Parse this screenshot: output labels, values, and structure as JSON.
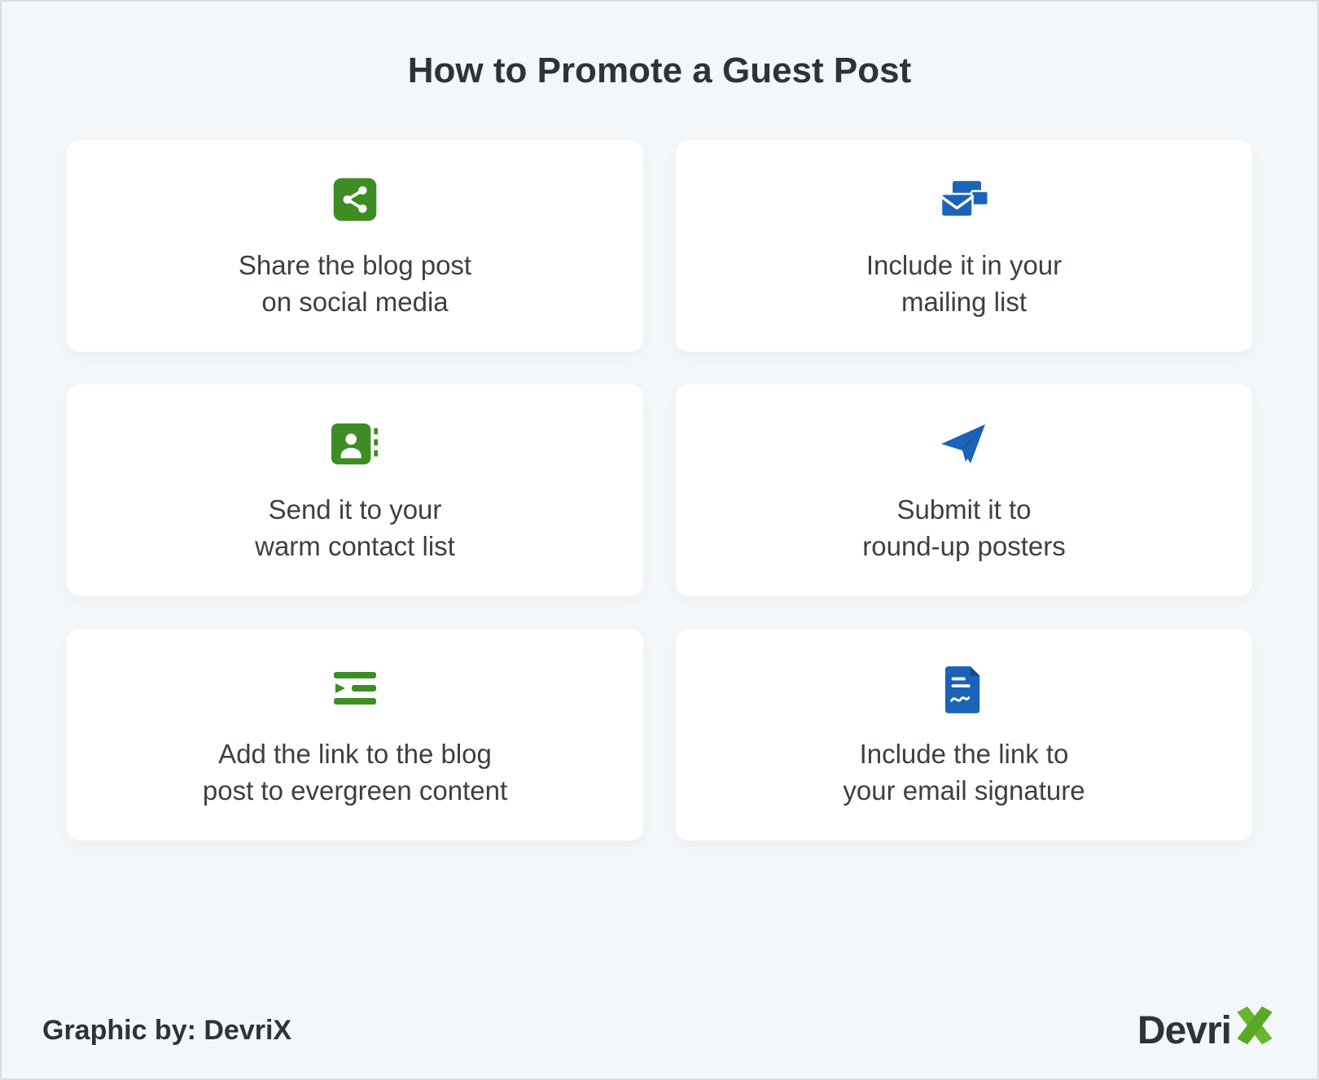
{
  "title": "How to Promote a Guest Post",
  "cards": [
    {
      "icon": "share",
      "color": "#3E8D24",
      "label": "Share the blog post\non social media"
    },
    {
      "icon": "mail-stack",
      "color": "#1A63B8",
      "label": "Include it in your\nmailing list"
    },
    {
      "icon": "contacts",
      "color": "#3E8D24",
      "label": "Send it to your\nwarm contact list"
    },
    {
      "icon": "paper-plane",
      "color": "#1A63B8",
      "label": "Submit it to\nround-up posters"
    },
    {
      "icon": "indent-list",
      "color": "#3E8D24",
      "label": "Add the link to the blog\npost to evergreen content"
    },
    {
      "icon": "signature",
      "color": "#1A63B8",
      "label": "Include the link to\nyour email signature"
    }
  ],
  "credit": "Graphic by: DevriX",
  "logo": {
    "text": "Devri",
    "accent": "X",
    "accent_color": "#68B62F"
  }
}
